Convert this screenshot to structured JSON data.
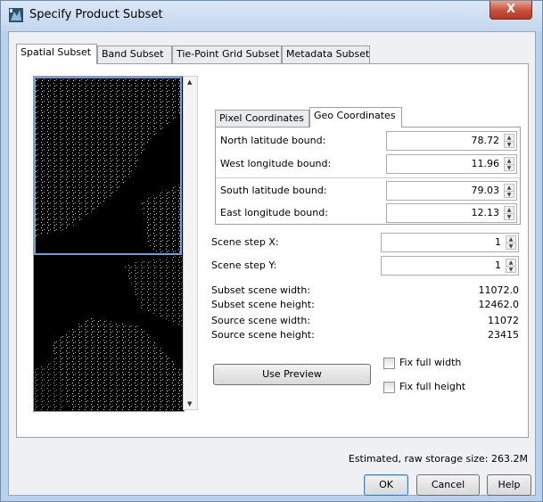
{
  "window": {
    "title": "Specify Product Subset",
    "close_label": "X"
  },
  "tabs": [
    "Spatial Subset",
    "Band Subset",
    "Tie-Point Grid Subset",
    "Metadata Subset"
  ],
  "coord_tabs": [
    "Pixel Coordinates",
    "Geo Coordinates"
  ],
  "geo": {
    "north_label": "North latitude bound:",
    "north_value": "78.72",
    "west_label": "West longitude bound:",
    "west_value": "11.96",
    "south_label": "South latitude bound:",
    "south_value": "79.03",
    "east_label": "East longitude bound:",
    "east_value": "12.13"
  },
  "step": {
    "x_label": "Scene step X:",
    "x_value": "1",
    "y_label": "Scene step Y:",
    "y_value": "1"
  },
  "info": {
    "subset_width_label": "Subset scene width:",
    "subset_width_value": "11072.0",
    "subset_height_label": "Subset scene height:",
    "subset_height_value": "12462.0",
    "source_width_label": "Source scene width:",
    "source_width_value": "11072",
    "source_height_label": "Source scene height:",
    "source_height_value": "23415"
  },
  "use_preview_label": "Use Preview",
  "fix_full_width_label": "Fix full width",
  "fix_full_height_label": "Fix full height",
  "storage_text": "Estimated, raw storage size: 263.2M",
  "buttons": {
    "ok": "OK",
    "cancel": "Cancel",
    "help": "Help"
  },
  "icons": {
    "app": "app-icon",
    "close": "close-icon"
  },
  "colors": {
    "title_bg": "#c3d6ec",
    "close_bg": "#c7503a",
    "selection": "#6e9ee0"
  }
}
